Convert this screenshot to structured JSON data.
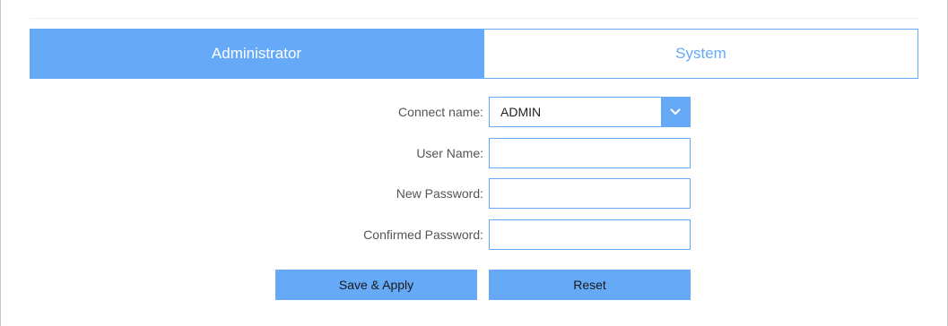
{
  "tabs": [
    {
      "label": "Administrator",
      "active": true
    },
    {
      "label": "System",
      "active": false
    }
  ],
  "form": {
    "connect_name": {
      "label": "Connect name:",
      "value": "ADMIN"
    },
    "user_name": {
      "label": "User Name:",
      "value": ""
    },
    "new_password": {
      "label": "New Password:",
      "value": ""
    },
    "confirmed_password": {
      "label": "Confirmed Password:",
      "value": ""
    }
  },
  "buttons": {
    "save_apply": "Save & Apply",
    "reset": "Reset"
  },
  "colors": {
    "accent": "#66aaf7",
    "label_text": "#555555"
  },
  "icons": {
    "dropdown": "chevron-down-icon"
  }
}
